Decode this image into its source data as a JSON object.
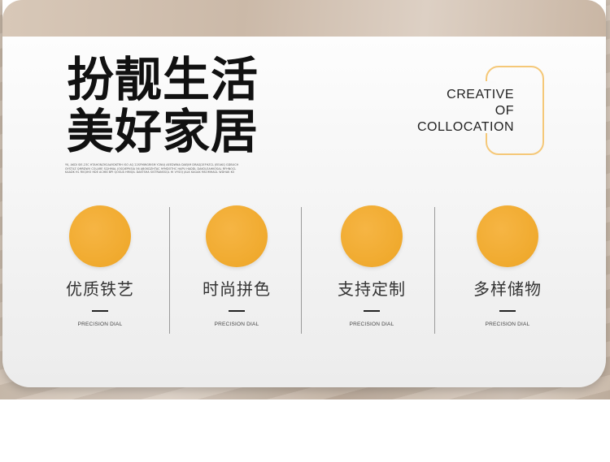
{
  "headline": {
    "line1": "扮靓生活",
    "line2": "美好家居"
  },
  "fine_print": "YK, AKDI SIE-23C HTAHONZH2AAYDKTRH ISO AQ 22SFMWGRISM Y2NUJ AEEDWNA DAEJIM DRAGJ2EFHZCL JEEAKQ GDBUCH GYSTUZ QMRDWV COLARE SCJHMAL JOSQIEPKSIA 56 ABOKDZHTAC 9YMDOTHC HAPU HADDL DAKOLEAHKOSAL RFHNOCL KAADK HL RVQIHO HDE ACHBI BPI QOSUA HMIQIL DAKTSHA SISTRANSSQL HI VYSOJ JALK KAGAK MSOMHAGL WDHAK KO",
  "creative": {
    "line1": "CREATIVE",
    "line2": "OF",
    "line3": "COLLOCATION"
  },
  "features": [
    {
      "title": "优质铁艺",
      "subtitle": "PRECISION DIAL"
    },
    {
      "title": "时尚拼色",
      "subtitle": "PRECISION DIAL"
    },
    {
      "title": "支持定制",
      "subtitle": "PRECISION DIAL"
    },
    {
      "title": "多样储物",
      "subtitle": "PRECISION DIAL"
    }
  ],
  "colors": {
    "accent": "#f0aa2e",
    "outline": "#f5c878",
    "text_dark": "#111111"
  }
}
